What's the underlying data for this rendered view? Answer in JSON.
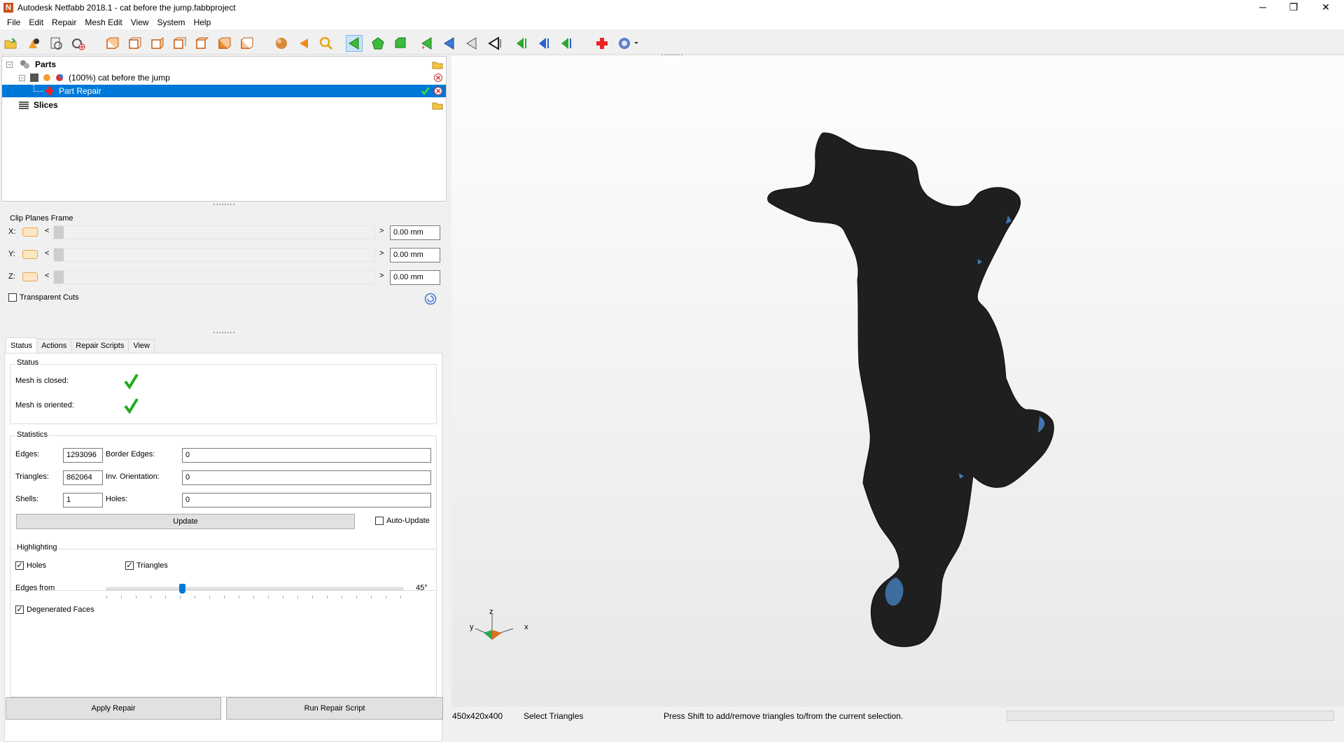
{
  "window": {
    "title": "Autodesk Netfabb 2018.1 - cat before the jump.fabbproject",
    "controls": {
      "minimize": "─",
      "restore": "❐",
      "close": "✕"
    }
  },
  "menu": [
    "File",
    "Edit",
    "Repair",
    "Mesh Edit",
    "View",
    "System",
    "Help"
  ],
  "tree": {
    "parts_label": "Parts",
    "part_label": "(100%) cat before the jump",
    "repair_label": "Part Repair",
    "slices_label": "Slices"
  },
  "clip": {
    "title": "Clip Planes Frame",
    "x_label": "X:",
    "y_label": "Y:",
    "z_label": "Z:",
    "x_value": "0.00 mm",
    "y_value": "0.00 mm",
    "z_value": "0.00 mm",
    "transparent_label": "Transparent Cuts"
  },
  "tabs": [
    "Status",
    "Actions",
    "Repair Scripts",
    "View"
  ],
  "status": {
    "group_title": "Status",
    "closed_label": "Mesh is closed:",
    "oriented_label": "Mesh is oriented:"
  },
  "statistics": {
    "group_title": "Statistics",
    "edges_label": "Edges:",
    "edges_value": "1293096",
    "border_edges_label": "Border Edges:",
    "border_edges_value": "0",
    "triangles_label": "Triangles:",
    "triangles_value": "862064",
    "inv_orientation_label": "Inv. Orientation:",
    "inv_orientation_value": "0",
    "shells_label": "Shells:",
    "shells_value": "1",
    "holes_label": "Holes:",
    "holes_value": "0",
    "update_label": "Update",
    "auto_update_label": "Auto-Update"
  },
  "highlighting": {
    "group_title": "Highlighting",
    "holes_label": "Holes",
    "triangles_label": "Triangles",
    "edges_from_label": "Edges from",
    "angle_value": "45°",
    "angle_fraction": 0.25,
    "degenerated_label": "Degenerated Faces"
  },
  "buttons": {
    "apply_repair": "Apply Repair",
    "run_script": "Run Repair Script"
  },
  "axis": {
    "z": "z",
    "y": "y",
    "x": "x"
  },
  "statusbar": {
    "dimensions": "450x420x400",
    "mode": "Select Triangles",
    "hint": "Press Shift to add/remove triangles to/from the current selection."
  },
  "colors": {
    "selection": "#0078d7",
    "mesh": "#1f1f1f",
    "highlight": "#4a8fd6"
  }
}
